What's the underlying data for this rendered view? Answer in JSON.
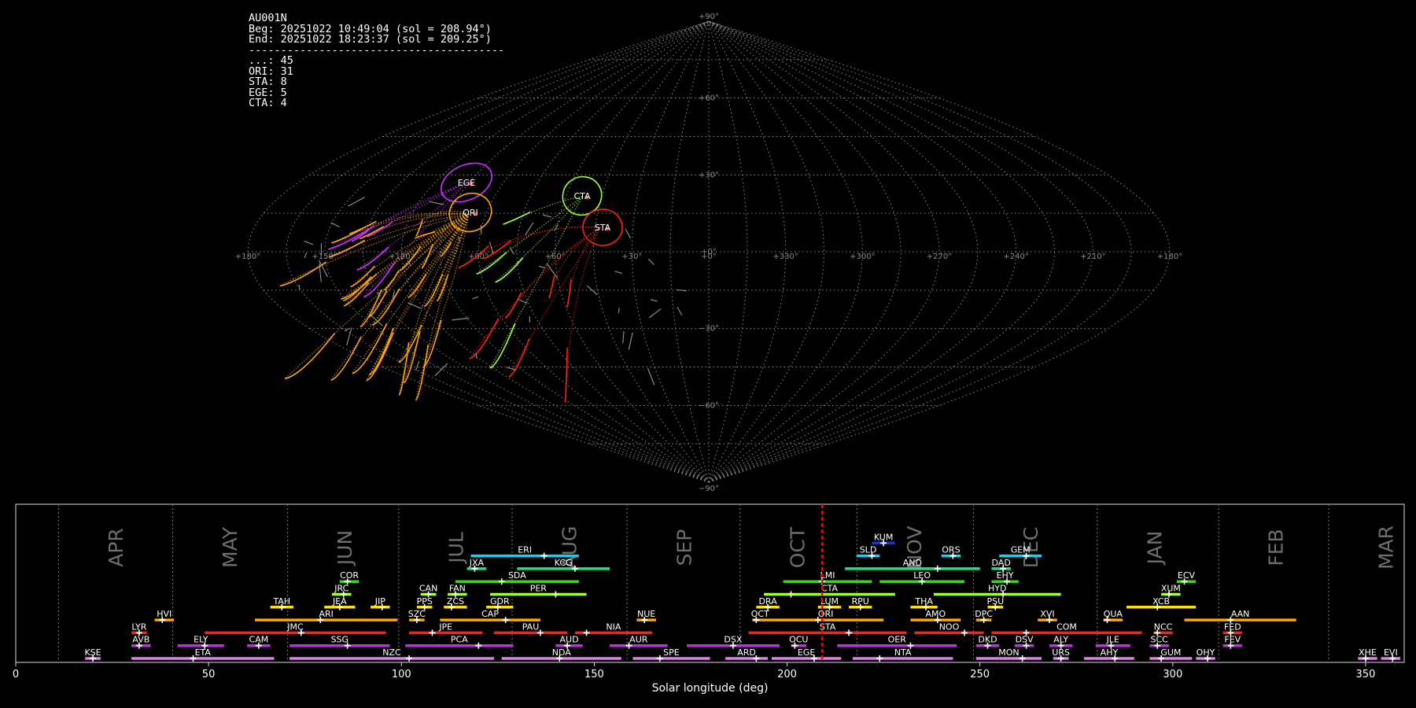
{
  "info": {
    "station": "AU001N",
    "begin": "Beg: 20251022 10:49:04 (sol = 208.94°)",
    "end": "End: 20251022 18:23:37 (sol = 209.25°)",
    "separator": "----------------------------------------",
    "counts": [
      {
        "label": "...",
        "count": 45
      },
      {
        "label": "ORI",
        "count": 31
      },
      {
        "label": "STA",
        "count": 8
      },
      {
        "label": "EGE",
        "count": 5
      },
      {
        "label": "CTA",
        "count": 4
      }
    ],
    "count_lines": [
      "...: 45",
      "ORI: 31",
      "STA: 8",
      "EGE: 5",
      "CTA: 4"
    ]
  },
  "colors": {
    "background": "#000000",
    "grid": "#8a8a8a",
    "sporadic": "#8a8a8a",
    "ORI": "#ffa500",
    "STA": "#ff2010",
    "EGE": "#d030ff",
    "CTA": "#a0ff30",
    "current_sol_marker": "#ff0000"
  },
  "chart_data": [
    {
      "type": "scatter",
      "projection": "sinusoidal",
      "grid": true,
      "lon_tick_labels": [
        "+180°",
        "+150°",
        "+120°",
        "+90°",
        "+60°",
        "+30°",
        "+0°",
        "+330°",
        "+300°",
        "+270°",
        "+240°",
        "+210°",
        "+180°"
      ],
      "lat_tick_labels": [
        "+90°",
        "+60°",
        "+30°",
        "+0°",
        "−30°",
        "−60°",
        "−90°"
      ],
      "lat_ticks": [
        90,
        60,
        30,
        0,
        -30,
        -60,
        -90
      ],
      "radiants": [
        {
          "code": "EGE",
          "lon": 102,
          "lat": 24,
          "color": "EGE"
        },
        {
          "code": "ORI",
          "lon": 95,
          "lat": 16,
          "color": "ORI"
        },
        {
          "code": "CTA",
          "lon": 52,
          "lat": 21,
          "color": "CTA"
        },
        {
          "code": "STA",
          "lon": 39,
          "lat": 11,
          "color": "STA"
        }
      ]
    },
    {
      "type": "timeline",
      "xlabel": "Solar longitude (deg)",
      "xlim": [
        0,
        360
      ],
      "x_ticks": [
        0,
        50,
        100,
        150,
        200,
        250,
        300,
        350
      ],
      "current_sol": 209.1,
      "months": [
        {
          "name": "APR",
          "start": 11.1
        },
        {
          "name": "MAY",
          "start": 40.7
        },
        {
          "name": "JUN",
          "start": 70.5
        },
        {
          "name": "JUL",
          "start": 99.3
        },
        {
          "name": "AUG",
          "start": 128.7
        },
        {
          "name": "SEP",
          "start": 158.5
        },
        {
          "name": "OCT",
          "start": 187.8
        },
        {
          "name": "NOV",
          "start": 218.1
        },
        {
          "name": "DEC",
          "start": 248.3
        },
        {
          "name": "JAN",
          "start": 280.4
        },
        {
          "name": "FEB",
          "start": 311.9
        },
        {
          "name": "MAR",
          "start": 340.4
        }
      ],
      "showers": [
        {
          "code": "KUM",
          "start": 222,
          "end": 228,
          "peak": 225,
          "row": 10,
          "color": "#1030ff"
        },
        {
          "code": "ERI",
          "start": 118,
          "end": 146,
          "peak": 137,
          "row": 9,
          "color": "#00d8ff"
        },
        {
          "code": "SLD",
          "start": 218,
          "end": 224,
          "peak": 222,
          "row": 9,
          "color": "#00d8ff"
        },
        {
          "code": "ORS",
          "start": 240,
          "end": 245,
          "peak": 243,
          "row": 9,
          "color": "#00d8ff"
        },
        {
          "code": "GEM",
          "start": 255,
          "end": 266,
          "peak": 262,
          "row": 9,
          "color": "#00d8ff"
        },
        {
          "code": "JXA",
          "start": 117,
          "end": 122,
          "peak": 119,
          "row": 8,
          "color": "#20e080"
        },
        {
          "code": "KCG",
          "start": 130,
          "end": 154,
          "peak": 145,
          "row": 8,
          "color": "#20e080"
        },
        {
          "code": "AND",
          "start": 215,
          "end": 250,
          "peak": 239,
          "row": 8,
          "color": "#20e080"
        },
        {
          "code": "DAD",
          "start": 253,
          "end": 258,
          "peak": 256,
          "row": 8,
          "color": "#20e080"
        },
        {
          "code": "COR",
          "start": 84,
          "end": 89,
          "peak": 86,
          "row": 7,
          "color": "#40d020"
        },
        {
          "code": "SDA",
          "start": 114,
          "end": 146,
          "peak": 126,
          "row": 7,
          "color": "#40d020"
        },
        {
          "code": "LMI",
          "start": 199,
          "end": 222,
          "peak": 209,
          "row": 7,
          "color": "#40d020"
        },
        {
          "code": "LEO",
          "start": 224,
          "end": 246,
          "peak": 235,
          "row": 7,
          "color": "#40d020"
        },
        {
          "code": "EHY",
          "start": 253,
          "end": 260,
          "peak": 257,
          "row": 7,
          "color": "#40d020"
        },
        {
          "code": "ECV",
          "start": 301,
          "end": 306,
          "peak": 303,
          "row": 7,
          "color": "#40d020"
        },
        {
          "code": "JRC",
          "start": 82,
          "end": 87,
          "peak": 85,
          "row": 6,
          "color": "#a0ff30"
        },
        {
          "code": "CAN",
          "start": 105,
          "end": 109,
          "peak": 107,
          "row": 6,
          "color": "#a0ff30"
        },
        {
          "code": "FAN",
          "start": 112,
          "end": 117,
          "peak": 114,
          "row": 6,
          "color": "#a0ff30"
        },
        {
          "code": "PER",
          "start": 123,
          "end": 148,
          "peak": 140,
          "row": 6,
          "color": "#a0ff30"
        },
        {
          "code": "CTA",
          "start": 194,
          "end": 228,
          "peak": 201,
          "row": 6,
          "color": "#a0ff30"
        },
        {
          "code": "HYD",
          "start": 238,
          "end": 271,
          "peak": 256,
          "row": 6,
          "color": "#a0ff30"
        },
        {
          "code": "XUM",
          "start": 297,
          "end": 302,
          "peak": 299,
          "row": 6,
          "color": "#a0ff30"
        },
        {
          "code": "TAH",
          "start": 66,
          "end": 72,
          "peak": 69,
          "row": 5,
          "color": "#ffe000"
        },
        {
          "code": "JEA",
          "start": 80,
          "end": 88,
          "peak": 84,
          "row": 5,
          "color": "#ffe000"
        },
        {
          "code": "JIP",
          "start": 92,
          "end": 97,
          "peak": 95,
          "row": 5,
          "color": "#ffe000"
        },
        {
          "code": "PPS",
          "start": 104,
          "end": 108,
          "peak": 106,
          "row": 5,
          "color": "#ffe000"
        },
        {
          "code": "ZCS",
          "start": 111,
          "end": 117,
          "peak": 113,
          "row": 5,
          "color": "#ffe000"
        },
        {
          "code": "GDR",
          "start": 122,
          "end": 129,
          "peak": 125,
          "row": 5,
          "color": "#ffe000"
        },
        {
          "code": "DRA",
          "start": 192,
          "end": 198,
          "peak": 195,
          "row": 5,
          "color": "#ffe000"
        },
        {
          "code": "LUM",
          "start": 208,
          "end": 214,
          "peak": 211,
          "row": 5,
          "color": "#ffe000"
        },
        {
          "code": "RPU",
          "start": 216,
          "end": 222,
          "peak": 219,
          "row": 5,
          "color": "#ffe000"
        },
        {
          "code": "THA",
          "start": 232,
          "end": 239,
          "peak": 236,
          "row": 5,
          "color": "#ffe000"
        },
        {
          "code": "PSU",
          "start": 252,
          "end": 256,
          "peak": 254,
          "row": 5,
          "color": "#ffe000"
        },
        {
          "code": "XCB",
          "start": 288,
          "end": 306,
          "peak": 296,
          "row": 5,
          "color": "#ffe000"
        },
        {
          "code": "HVI",
          "start": 36,
          "end": 41,
          "peak": 38,
          "row": 4,
          "color": "#ffa500"
        },
        {
          "code": "ARI",
          "start": 62,
          "end": 99,
          "peak": 79,
          "row": 4,
          "color": "#ffa500"
        },
        {
          "code": "SZC",
          "start": 102,
          "end": 106,
          "peak": 104,
          "row": 4,
          "color": "#ffa500"
        },
        {
          "code": "CAP",
          "start": 110,
          "end": 136,
          "peak": 127,
          "row": 4,
          "color": "#ffa500"
        },
        {
          "code": "NUE",
          "start": 161,
          "end": 166,
          "peak": 163,
          "row": 4,
          "color": "#ffa500"
        },
        {
          "code": "OCT",
          "start": 191,
          "end": 195,
          "peak": 192,
          "row": 4,
          "color": "#ffa500"
        },
        {
          "code": "ORI",
          "start": 195,
          "end": 225,
          "peak": 208,
          "row": 4,
          "color": "#ffa500"
        },
        {
          "code": "AMO",
          "start": 232,
          "end": 245,
          "peak": 239,
          "row": 4,
          "color": "#ffa500"
        },
        {
          "code": "DPC",
          "start": 249,
          "end": 253,
          "peak": 251,
          "row": 4,
          "color": "#ffa500"
        },
        {
          "code": "XVI",
          "start": 265,
          "end": 270,
          "peak": 268,
          "row": 4,
          "color": "#ffa500"
        },
        {
          "code": "QUA",
          "start": 282,
          "end": 287,
          "peak": 283,
          "row": 4,
          "color": "#ffa500"
        },
        {
          "code": "AAN",
          "start": 303,
          "end": 332,
          "peak": 315,
          "row": 4,
          "color": "#ffa500"
        },
        {
          "code": "LYR",
          "start": 30,
          "end": 34,
          "peak": 32,
          "row": 3,
          "color": "#ff2010"
        },
        {
          "code": "JMC",
          "start": 49,
          "end": 96,
          "peak": 74,
          "row": 3,
          "color": "#ff2010"
        },
        {
          "code": "JPE",
          "start": 102,
          "end": 121,
          "peak": 108,
          "row": 3,
          "color": "#ff2010"
        },
        {
          "code": "PAU",
          "start": 124,
          "end": 143,
          "peak": 136,
          "row": 3,
          "color": "#ff2010"
        },
        {
          "code": "NIA",
          "start": 145,
          "end": 165,
          "peak": 148,
          "row": 3,
          "color": "#ff2010"
        },
        {
          "code": "STA",
          "start": 190,
          "end": 231,
          "peak": 216,
          "row": 3,
          "color": "#ff2010"
        },
        {
          "code": "NOO",
          "start": 233,
          "end": 251,
          "peak": 246,
          "row": 3,
          "color": "#ff2010"
        },
        {
          "code": "COM",
          "start": 253,
          "end": 292,
          "peak": 262,
          "row": 3,
          "color": "#ff2010"
        },
        {
          "code": "NCC",
          "start": 295,
          "end": 300,
          "peak": 296,
          "row": 3,
          "color": "#ff2010"
        },
        {
          "code": "FED",
          "start": 313,
          "end": 318,
          "peak": 315,
          "row": 3,
          "color": "#ff2010"
        },
        {
          "code": "AVB",
          "start": 30,
          "end": 35,
          "peak": 32,
          "row": 2,
          "color": "#c030e0"
        },
        {
          "code": "ELY",
          "start": 42,
          "end": 54,
          "peak": 49,
          "row": 2,
          "color": "#c030e0"
        },
        {
          "code": "CAM",
          "start": 60,
          "end": 66,
          "peak": 63,
          "row": 2,
          "color": "#c030e0"
        },
        {
          "code": "SSG",
          "start": 71,
          "end": 97,
          "peak": 86,
          "row": 2,
          "color": "#c030e0"
        },
        {
          "code": "PCA",
          "start": 101,
          "end": 129,
          "peak": 120,
          "row": 2,
          "color": "#c030e0"
        },
        {
          "code": "AUD",
          "start": 140,
          "end": 147,
          "peak": 143,
          "row": 2,
          "color": "#c030e0"
        },
        {
          "code": "AUR",
          "start": 154,
          "end": 169,
          "peak": 159,
          "row": 2,
          "color": "#c030e0"
        },
        {
          "code": "DSX",
          "start": 174,
          "end": 198,
          "peak": 186,
          "row": 2,
          "color": "#c030e0"
        },
        {
          "code": "OCU",
          "start": 201,
          "end": 205,
          "peak": 202,
          "row": 2,
          "color": "#c030e0"
        },
        {
          "code": "OER",
          "start": 213,
          "end": 244,
          "peak": 232,
          "row": 2,
          "color": "#c030e0"
        },
        {
          "code": "DKD",
          "start": 249,
          "end": 255,
          "peak": 252,
          "row": 2,
          "color": "#c030e0"
        },
        {
          "code": "DSV",
          "start": 259,
          "end": 264,
          "peak": 262,
          "row": 2,
          "color": "#c030e0"
        },
        {
          "code": "ALY",
          "start": 268,
          "end": 274,
          "peak": 271,
          "row": 2,
          "color": "#c030e0"
        },
        {
          "code": "JLE",
          "start": 280,
          "end": 289,
          "peak": 284,
          "row": 2,
          "color": "#c030e0"
        },
        {
          "code": "SCC",
          "start": 294,
          "end": 299,
          "peak": 296,
          "row": 2,
          "color": "#c030e0"
        },
        {
          "code": "FEV",
          "start": 313,
          "end": 318,
          "peak": 315,
          "row": 2,
          "color": "#c030e0"
        },
        {
          "code": "KSE",
          "start": 18,
          "end": 22,
          "peak": 20,
          "row": 1,
          "color": "#e080e8"
        },
        {
          "code": "ETA",
          "start": 30,
          "end": 67,
          "peak": 46,
          "row": 1,
          "color": "#e080e8"
        },
        {
          "code": "NZC",
          "start": 71,
          "end": 124,
          "peak": 102,
          "row": 1,
          "color": "#e080e8"
        },
        {
          "code": "NDA",
          "start": 126,
          "end": 157,
          "peak": 141,
          "row": 1,
          "color": "#e080e8"
        },
        {
          "code": "SPE",
          "start": 160,
          "end": 180,
          "peak": 167,
          "row": 1,
          "color": "#e080e8"
        },
        {
          "code": "ARD",
          "start": 184,
          "end": 195,
          "peak": 192,
          "row": 1,
          "color": "#e080e8"
        },
        {
          "code": "EGE",
          "start": 196,
          "end": 214,
          "peak": 207,
          "row": 1,
          "color": "#e080e8"
        },
        {
          "code": "NTA",
          "start": 217,
          "end": 243,
          "peak": 224,
          "row": 1,
          "color": "#e080e8"
        },
        {
          "code": "MON",
          "start": 249,
          "end": 266,
          "peak": 261,
          "row": 1,
          "color": "#e080e8"
        },
        {
          "code": "URS",
          "start": 269,
          "end": 273,
          "peak": 271,
          "row": 1,
          "color": "#e080e8"
        },
        {
          "code": "AHY",
          "start": 277,
          "end": 290,
          "peak": 285,
          "row": 1,
          "color": "#e080e8"
        },
        {
          "code": "GUM",
          "start": 294,
          "end": 305,
          "peak": 297,
          "row": 1,
          "color": "#e080e8"
        },
        {
          "code": "OHY",
          "start": 306,
          "end": 311,
          "peak": 309,
          "row": 1,
          "color": "#e080e8"
        },
        {
          "code": "XHE",
          "start": 348,
          "end": 353,
          "peak": 350,
          "row": 1,
          "color": "#e080e8"
        },
        {
          "code": "EVI",
          "start": 354,
          "end": 359,
          "peak": 357,
          "row": 1,
          "color": "#e080e8"
        }
      ]
    }
  ]
}
